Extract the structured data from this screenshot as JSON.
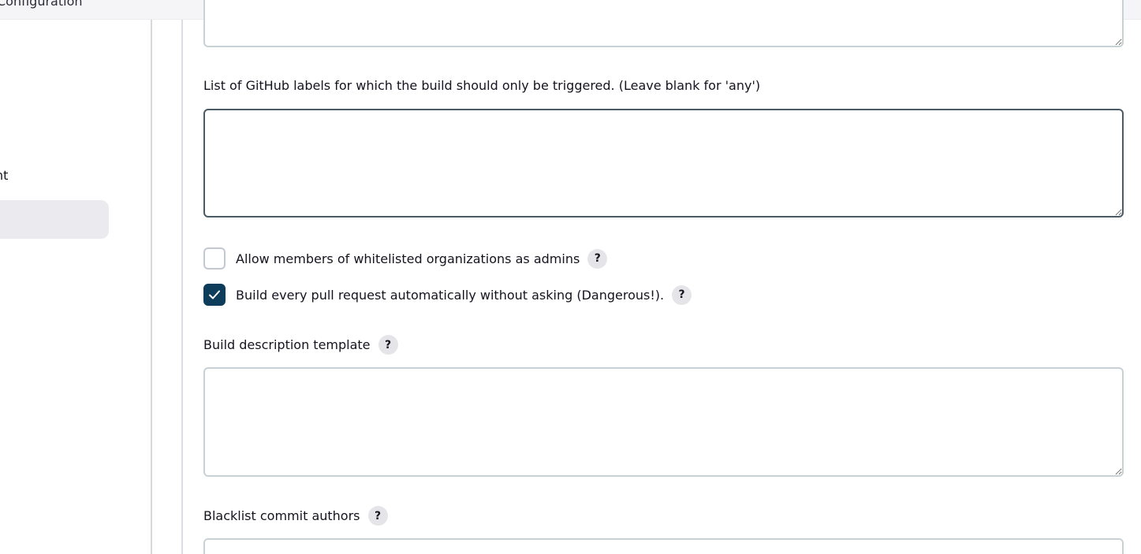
{
  "topbar": {
    "title": "Configuration"
  },
  "sidebar": {
    "partial_item": "nt"
  },
  "form": {
    "labels_field": {
      "label": "List of GitHub labels for which the build should only be triggered. (Leave blank for 'any')",
      "value": ""
    },
    "allow_whitelisted_admins": {
      "label": "Allow members of whitelisted organizations as admins",
      "checked": false,
      "help": "?"
    },
    "build_every_pr": {
      "label": "Build every pull request automatically without asking (Dangerous!).",
      "checked": true,
      "help": "?"
    },
    "build_description": {
      "label": "Build description template",
      "help": "?",
      "value": ""
    },
    "blacklist_authors": {
      "label": "Blacklist commit authors",
      "help": "?",
      "value": ""
    }
  },
  "colors": {
    "checkbox_checked": "#0d3d5a",
    "field_border": "#c8d2d6",
    "field_border_focused": "#4a5b66",
    "help_bg": "#e5e5e9"
  }
}
